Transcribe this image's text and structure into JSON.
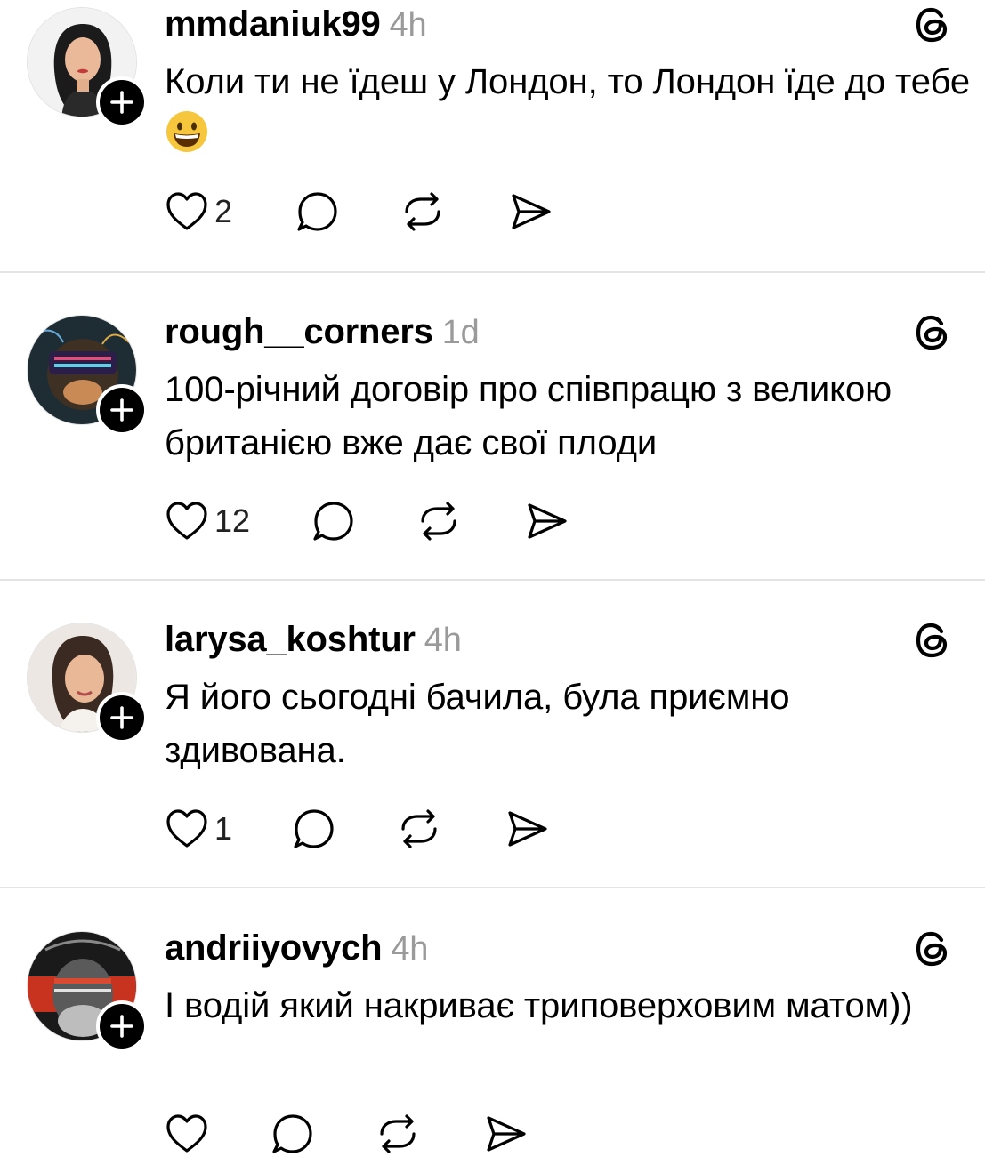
{
  "posts": [
    {
      "username": "mmdaniuk99",
      "time": "4h",
      "text": "Коли ти не їдеш у Лондон, то Лондон їде до тебе",
      "emoji": "grinning-face",
      "likes": "2",
      "avatar": "woman-portrait-dark-hair"
    },
    {
      "username": "rough__corners",
      "time": "1d",
      "text": "100-річний договір про співпрацю з великою британією вже дає свої плоди",
      "likes": "12",
      "avatar": "monkey-vr-headset-art"
    },
    {
      "username": "larysa_koshtur",
      "time": "4h",
      "text": "Я його сьогодні бачила, була приємно здивована.",
      "likes": "1",
      "avatar": "woman-portrait-smiling"
    },
    {
      "username": "andriiyovych",
      "time": "4h",
      "text": "І водій який накриває триповерховим матом))",
      "likes": "",
      "avatar": "glitch-face-art"
    }
  ],
  "icons": [
    "plus-icon",
    "threads-icon",
    "heart-icon",
    "comment-icon",
    "repost-icon",
    "share-icon"
  ],
  "colors": {
    "background": "#ffffff",
    "text": "#000000",
    "muted": "#9a9a9a",
    "divider": "#e4e4e4"
  }
}
